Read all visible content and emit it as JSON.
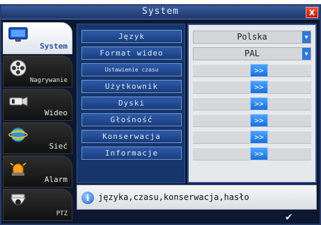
{
  "window": {
    "title": "System",
    "close_label": "X"
  },
  "sidebar": {
    "items": [
      {
        "label": "System"
      },
      {
        "label": "Nagrywanie"
      },
      {
        "label": "Wideo"
      },
      {
        "label": "Sieć"
      },
      {
        "label": "Alarm"
      },
      {
        "label": "PTZ"
      }
    ]
  },
  "menu": {
    "items": [
      {
        "label": "Język"
      },
      {
        "label": "Format wideo"
      },
      {
        "label": "Ustawienie czasu"
      },
      {
        "label": "Użytkownik"
      },
      {
        "label": "Dyski"
      },
      {
        "label": "Głośność"
      },
      {
        "label": "Konserwacja"
      },
      {
        "label": "Informacje"
      }
    ]
  },
  "values": {
    "language": "Polska",
    "video_format": "PAL",
    "arrow_label": ">>"
  },
  "help": {
    "text": "języka,czasu,konserwacja,hasło",
    "info_icon": "i"
  },
  "colors": {
    "accent": "#2f76d8",
    "background": "#0d1730"
  }
}
